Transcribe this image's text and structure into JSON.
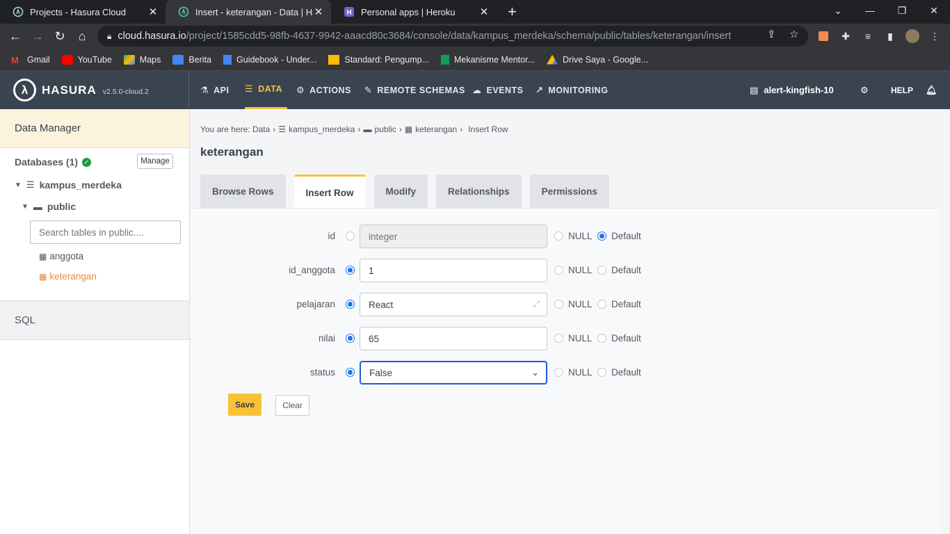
{
  "browser": {
    "tabs": [
      {
        "title": "Projects - Hasura Cloud",
        "close": "✕"
      },
      {
        "title": "Insert - keterangan - Data | Hasura",
        "close": "✕"
      },
      {
        "title": "Personal apps | Heroku",
        "close": "✕"
      }
    ],
    "new_tab": "+",
    "url_host": "cloud.hasura.io",
    "url_path": "/project/1585cdd5-98fb-4637-9942-aaacd80c3684/console/data/kampus_merdeka/schema/public/tables/keterangan/insert",
    "bookmarks": [
      {
        "label": "Gmail",
        "icon": "gmail-icon",
        "color": "#ea4335"
      },
      {
        "label": "YouTube",
        "icon": "youtube-icon",
        "color": "#ff0000"
      },
      {
        "label": "Maps",
        "icon": "maps-icon",
        "color": "#34a853"
      },
      {
        "label": "Berita",
        "icon": "news-icon",
        "color": "#4285f4"
      },
      {
        "label": "Guidebook - Under...",
        "icon": "docs-icon",
        "color": "#4285f4"
      },
      {
        "label": "Standard: Pengump...",
        "icon": "slides-icon",
        "color": "#fbbc04"
      },
      {
        "label": "Mekanisme Mentor...",
        "icon": "sheets-icon",
        "color": "#0f9d58"
      },
      {
        "label": "Drive Saya - Google...",
        "icon": "drive-icon",
        "color": "#fbbc04"
      }
    ]
  },
  "hasura_nav": {
    "logo_text": "HASURA",
    "version": "v2.5.0-cloud.2",
    "items": [
      {
        "label": "API",
        "icon": "flask-icon"
      },
      {
        "label": "DATA",
        "icon": "database-icon"
      },
      {
        "label": "ACTIONS",
        "icon": "cogs-icon"
      },
      {
        "label": "REMOTE SCHEMAS",
        "icon": "plug-icon"
      },
      {
        "label": "EVENTS",
        "icon": "cloud-icon"
      },
      {
        "label": "MONITORING",
        "icon": "chart-line-icon"
      }
    ],
    "project_name": "alert-kingfish-10",
    "help": "HELP",
    "accent": "#f8c238"
  },
  "sidebar": {
    "title": "Data Manager",
    "databases_label": "Databases (1)",
    "manage_label": "Manage",
    "database_name": "kampus_merdeka",
    "schema_name": "public",
    "search_placeholder": "Search tables in public....",
    "tables": [
      "anggota",
      "keterangan"
    ],
    "sql_label": "SQL"
  },
  "main": {
    "breadcrumb": [
      "You are here: Data",
      "kampus_merdeka",
      "public",
      "keterangan",
      "Insert Row"
    ],
    "title": "keterangan",
    "tabs": [
      "Browse Rows",
      "Insert Row",
      "Modify",
      "Relationships",
      "Permissions"
    ],
    "fields": [
      {
        "label": "id",
        "value": "",
        "placeholder": "integer",
        "null_label": "NULL",
        "default_label": "Default"
      },
      {
        "label": "id_anggota",
        "value": "1",
        "null_label": "NULL",
        "default_label": "Default"
      },
      {
        "label": "pelajaran",
        "value": "React",
        "null_label": "NULL",
        "default_label": "Default"
      },
      {
        "label": "nilai",
        "value": "65",
        "null_label": "NULL",
        "default_label": "Default"
      },
      {
        "label": "status",
        "value": "False",
        "null_label": "NULL",
        "default_label": "Default"
      }
    ],
    "save_label": "Save",
    "clear_label": "Clear"
  }
}
